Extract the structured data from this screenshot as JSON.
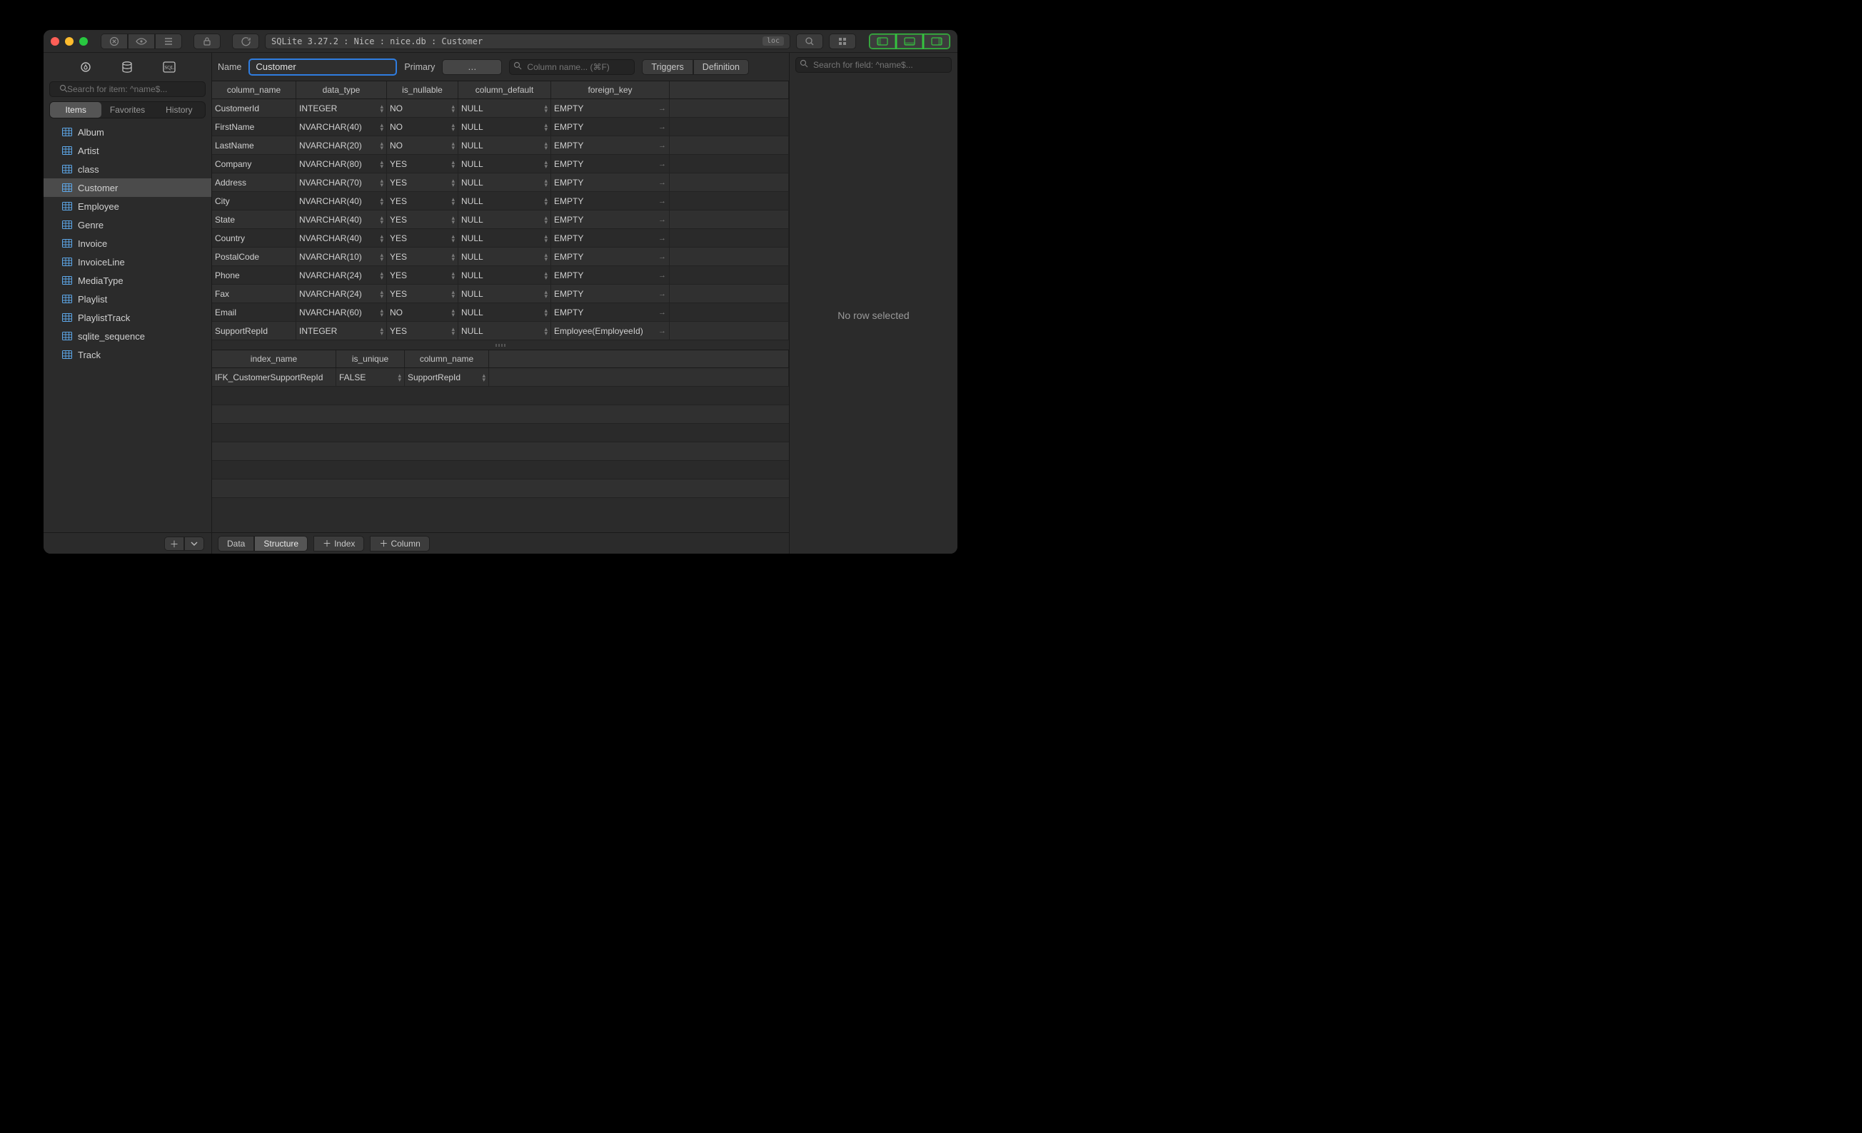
{
  "title_path": "SQLite 3.27.2 : Nice : nice.db : Customer",
  "title_badge": "loc",
  "sidebar": {
    "search_placeholder": "Search for item: ^name$...",
    "tabs": [
      "Items",
      "Favorites",
      "History"
    ],
    "active_tab": 0,
    "items": [
      "Album",
      "Artist",
      "class",
      "Customer",
      "Employee",
      "Genre",
      "Invoice",
      "InvoiceLine",
      "MediaType",
      "Playlist",
      "PlaylistTrack",
      "sqlite_sequence",
      "Track"
    ],
    "selected": "Customer"
  },
  "namebar": {
    "name_label": "Name",
    "name_value": "Customer",
    "primary_label": "Primary",
    "primary_value": "…",
    "col_search_placeholder": "Column name... (⌘F)",
    "seg": [
      "Triggers",
      "Definition"
    ]
  },
  "columns_grid": {
    "headers": [
      "column_name",
      "data_type",
      "is_nullable",
      "column_default",
      "foreign_key"
    ],
    "rows": [
      {
        "name": "CustomerId",
        "type": "INTEGER",
        "null": "NO",
        "def": "NULL",
        "fk": "EMPTY"
      },
      {
        "name": "FirstName",
        "type": "NVARCHAR(40)",
        "null": "NO",
        "def": "NULL",
        "fk": "EMPTY"
      },
      {
        "name": "LastName",
        "type": "NVARCHAR(20)",
        "null": "NO",
        "def": "NULL",
        "fk": "EMPTY"
      },
      {
        "name": "Company",
        "type": "NVARCHAR(80)",
        "null": "YES",
        "def": "NULL",
        "fk": "EMPTY"
      },
      {
        "name": "Address",
        "type": "NVARCHAR(70)",
        "null": "YES",
        "def": "NULL",
        "fk": "EMPTY"
      },
      {
        "name": "City",
        "type": "NVARCHAR(40)",
        "null": "YES",
        "def": "NULL",
        "fk": "EMPTY"
      },
      {
        "name": "State",
        "type": "NVARCHAR(40)",
        "null": "YES",
        "def": "NULL",
        "fk": "EMPTY"
      },
      {
        "name": "Country",
        "type": "NVARCHAR(40)",
        "null": "YES",
        "def": "NULL",
        "fk": "EMPTY"
      },
      {
        "name": "PostalCode",
        "type": "NVARCHAR(10)",
        "null": "YES",
        "def": "NULL",
        "fk": "EMPTY"
      },
      {
        "name": "Phone",
        "type": "NVARCHAR(24)",
        "null": "YES",
        "def": "NULL",
        "fk": "EMPTY"
      },
      {
        "name": "Fax",
        "type": "NVARCHAR(24)",
        "null": "YES",
        "def": "NULL",
        "fk": "EMPTY"
      },
      {
        "name": "Email",
        "type": "NVARCHAR(60)",
        "null": "NO",
        "def": "NULL",
        "fk": "EMPTY"
      },
      {
        "name": "SupportRepId",
        "type": "INTEGER",
        "null": "YES",
        "def": "NULL",
        "fk": "Employee(EmployeeId)"
      }
    ]
  },
  "index_grid": {
    "headers": [
      "index_name",
      "is_unique",
      "column_name"
    ],
    "rows": [
      {
        "name": "IFK_CustomerSupportRepId",
        "unique": "FALSE",
        "col": "SupportRepId"
      }
    ]
  },
  "bottom": {
    "view_tabs": [
      "Data",
      "Structure"
    ],
    "active_tab": 1,
    "add_index": "Index",
    "add_column": "Column"
  },
  "detail": {
    "search_placeholder": "Search for field: ^name$...",
    "empty": "No row selected"
  }
}
